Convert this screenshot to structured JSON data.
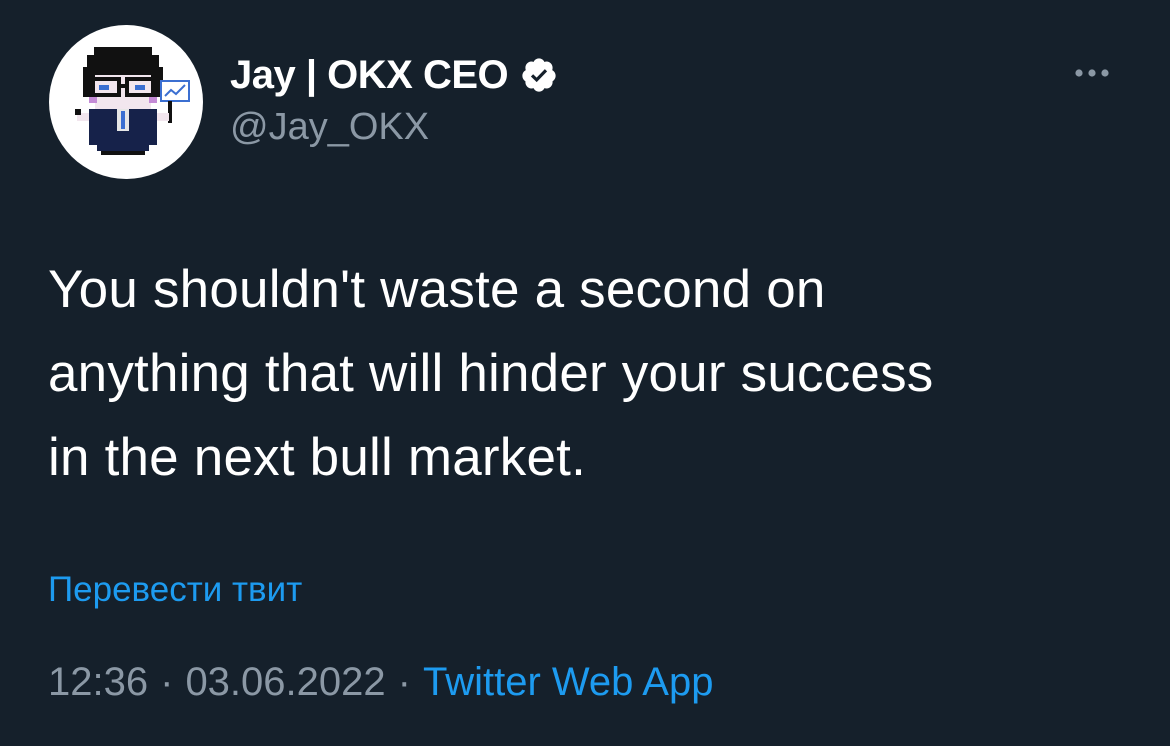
{
  "author": {
    "display_name": "Jay | OKX CEO",
    "handle": "@Jay_OKX",
    "verified_icon": "verified-badge-icon",
    "avatar_icon": "pixel-art-avatar"
  },
  "tweet": {
    "lines": [
      "You shouldn't waste a second on",
      "anything that will hinder your success",
      "in the next bull market."
    ],
    "translate_label": "Перевести твит"
  },
  "meta": {
    "time": "12:36",
    "separator": "·",
    "date": "03.06.2022",
    "source": "Twitter Web App"
  },
  "icons": {
    "more": "more-options-icon"
  },
  "colors": {
    "background": "#15202b",
    "text": "#ffffff",
    "secondary": "#8b98a5",
    "accent": "#1d9bf0"
  }
}
